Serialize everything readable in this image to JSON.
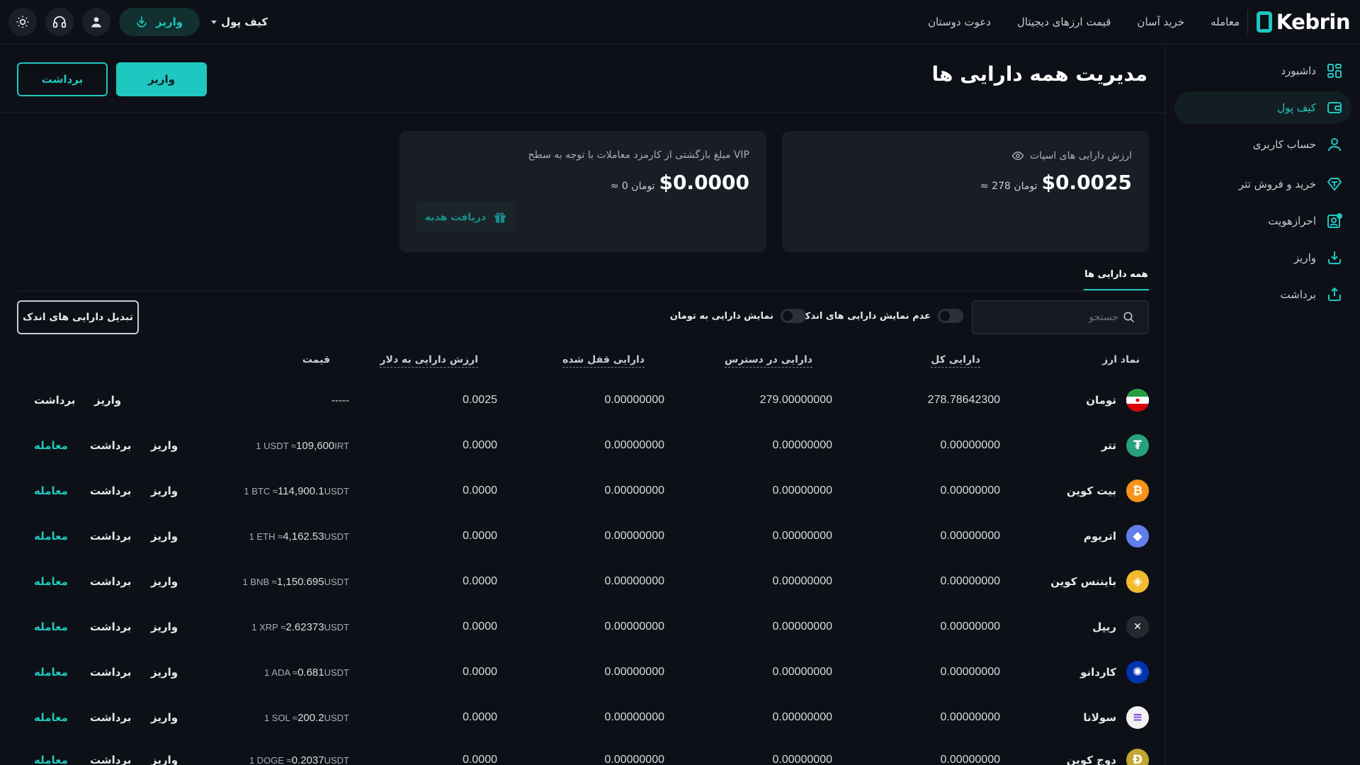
{
  "brand": {
    "name": "Kebrin"
  },
  "nav": [
    "معامله",
    "خرید آسان",
    "قیمت ارزهای دیجیتال",
    "دعوت دوستان"
  ],
  "topbar": {
    "wallet_label": "کیف پول",
    "deposit_label": "واریز"
  },
  "sidebar": {
    "items": [
      {
        "label": "داشبورد",
        "icon": "dashboard-icon"
      },
      {
        "label": "کیف پول",
        "icon": "wallet-icon",
        "active": true
      },
      {
        "label": "حساب کاربری",
        "icon": "user-icon"
      },
      {
        "label": "خرید و فروش تتر",
        "icon": "tether-icon"
      },
      {
        "label": "احرازهویت",
        "icon": "verify-icon"
      },
      {
        "label": "واریز",
        "icon": "deposit-icon"
      },
      {
        "label": "برداشت",
        "icon": "withdraw-icon"
      }
    ]
  },
  "page": {
    "title": "مدیریت همه دارایی ها",
    "deposit_btn": "واریز",
    "withdraw_btn": "برداشت"
  },
  "cards": {
    "spot": {
      "label": "ارزش دارایی های اسپات",
      "value": "$0.0025",
      "equiv": "≈ 278 تومان"
    },
    "vip": {
      "label": "مبلغ بازگشتی از کارمزد معاملات با توجه به سطح VIP",
      "value": "$0.0000",
      "equiv": "≈ 0 تومان",
      "gift_btn": "دریافت هدیه"
    }
  },
  "tabs": {
    "active": "همه دارایی ها"
  },
  "filters": {
    "search_placeholder": "جستجو",
    "hide_small": "عدم نمایش دارایی های اندک",
    "show_toman": "نمایش دارایی به تومان",
    "convert_btn": "تبدیل دارایی های اندک"
  },
  "table": {
    "headers": [
      "نماد ارز",
      "دارایی کل",
      "دارایی در دسترس",
      "دارایی قفل شده",
      "ارزش دارایی به دلار",
      "قیمت"
    ],
    "actions": {
      "deposit": "واریز",
      "withdraw": "برداشت",
      "trade": "معامله"
    },
    "rows": [
      {
        "name": "تومان",
        "total": "278.78642300",
        "available": "279.00000000",
        "locked": "0.00000000",
        "usd": "0.0025",
        "price_prefix": "",
        "price_main": "-----",
        "price_unit": "",
        "icon": "iran-flag-icon",
        "color": "#ffffff",
        "glyph": "",
        "trade": false
      },
      {
        "name": "تتر",
        "total": "0.00000000",
        "available": "0.00000000",
        "locked": "0.00000000",
        "usd": "0.0000",
        "price_prefix": "1 USDT ≈ ",
        "price_main": "109,600",
        "price_unit": " IRT",
        "icon": "tether-coin-icon",
        "color": "#26a17b",
        "glyph": "₮",
        "trade": true
      },
      {
        "name": "بیت کوین",
        "total": "0.00000000",
        "available": "0.00000000",
        "locked": "0.00000000",
        "usd": "0.0000",
        "price_prefix": "1 BTC ≈ ",
        "price_main": "114,900.1",
        "price_unit": " USDT",
        "icon": "bitcoin-icon",
        "color": "#f7931a",
        "glyph": "₿",
        "trade": true
      },
      {
        "name": "اتریوم",
        "total": "0.00000000",
        "available": "0.00000000",
        "locked": "0.00000000",
        "usd": "0.0000",
        "price_prefix": "1 ETH ≈ ",
        "price_main": "4,162.53",
        "price_unit": " USDT",
        "icon": "ethereum-icon",
        "color": "#627eea",
        "glyph": "◆",
        "trade": true
      },
      {
        "name": "بایننس کوین",
        "total": "0.00000000",
        "available": "0.00000000",
        "locked": "0.00000000",
        "usd": "0.0000",
        "price_prefix": "1 BNB ≈ ",
        "price_main": "1,150.695",
        "price_unit": " USDT",
        "icon": "bnb-icon",
        "color": "#f3ba2f",
        "glyph": "◈",
        "trade": true
      },
      {
        "name": "ریپل",
        "total": "0.00000000",
        "available": "0.00000000",
        "locked": "0.00000000",
        "usd": "0.0000",
        "price_prefix": "1 XRP ≈ ",
        "price_main": "2.62373",
        "price_unit": " USDT",
        "icon": "xrp-icon",
        "color": "#23292f",
        "glyph": "✕",
        "trade": true
      },
      {
        "name": "کاردانو",
        "total": "0.00000000",
        "available": "0.00000000",
        "locked": "0.00000000",
        "usd": "0.0000",
        "price_prefix": "1 ADA ≈ ",
        "price_main": "0.681",
        "price_unit": " USDT",
        "icon": "cardano-icon",
        "color": "#0033ad",
        "glyph": "✺",
        "trade": true
      },
      {
        "name": "سولانا",
        "total": "0.00000000",
        "available": "0.00000000",
        "locked": "0.00000000",
        "usd": "0.0000",
        "price_prefix": "1 SOL ≈ ",
        "price_main": "200.2",
        "price_unit": " USDT",
        "icon": "solana-icon",
        "color": "#f2f2f2",
        "glyph": "≡",
        "trade": true
      },
      {
        "name": "دوج کوین",
        "total": "0.00000000",
        "available": "0.00000000",
        "locked": "0.00000000",
        "usd": "0.0000",
        "price_prefix": "1 DOGE ≈ ",
        "price_main": "0.2037",
        "price_unit": " USDT",
        "icon": "dogecoin-icon",
        "color": "#c2a633",
        "glyph": "Ð",
        "trade": true
      }
    ]
  },
  "colors": {
    "accent": "#1fc7c1",
    "background": "#0d1016",
    "card": "#191e26"
  }
}
